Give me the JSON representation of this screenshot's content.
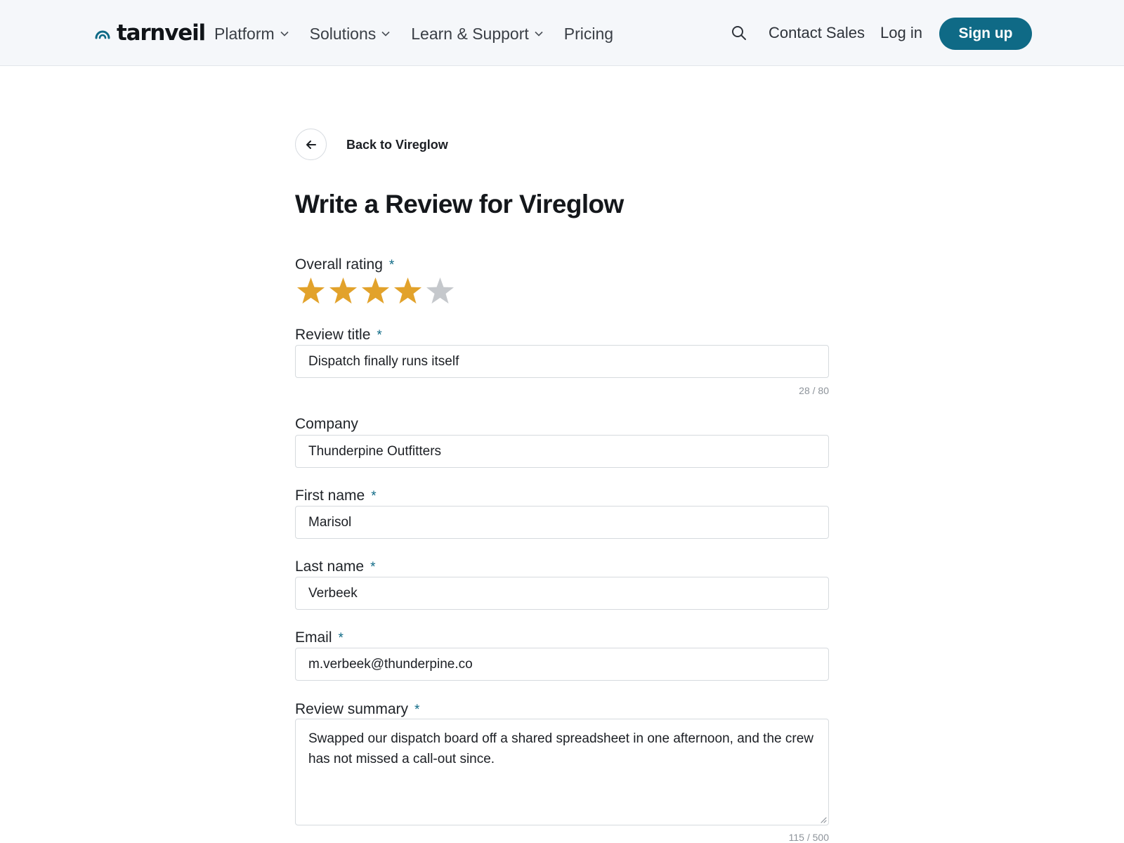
{
  "header": {
    "brand": "tarnveil",
    "nav": [
      {
        "label": "Platform",
        "has_dropdown": true
      },
      {
        "label": "Solutions",
        "has_dropdown": true
      },
      {
        "label": "Learn & Support",
        "has_dropdown": true
      },
      {
        "label": "Pricing",
        "has_dropdown": false
      }
    ],
    "search_icon": "search-icon",
    "contact_sales": "Contact Sales",
    "login": "Log in",
    "signup": "Sign up",
    "accent_color": "#0f6a86"
  },
  "back": {
    "label": "Back to Vireglow",
    "icon": "arrow-left-icon"
  },
  "page_title": "Write a Review for Vireglow",
  "required_marker": "*",
  "rating": {
    "label": "Overall rating",
    "value": 4,
    "max": 5,
    "filled_color": "#e2a22b",
    "empty_color": "#c5c8cc"
  },
  "fields": {
    "review_title": {
      "label": "Review title",
      "value": "Dispatch finally runs itself",
      "counter": "28 / 80"
    },
    "company": {
      "label": "Company",
      "value": "Thunderpine Outfitters"
    },
    "first_name": {
      "label": "First name",
      "value": "Marisol"
    },
    "last_name": {
      "label": "Last name",
      "value": "Verbeek"
    },
    "email": {
      "label": "Email",
      "value": "m.verbeek@thunderpine.co"
    },
    "review_summary": {
      "label": "Review summary",
      "value": "Swapped our dispatch board off a shared spreadsheet in one afternoon, and the crew has not missed a call-out since.",
      "counter": "115 / 500"
    }
  }
}
